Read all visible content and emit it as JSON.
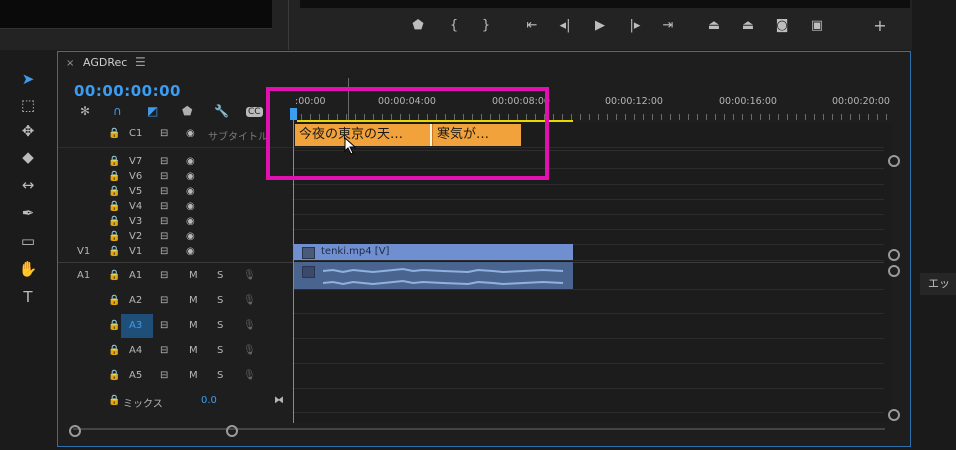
{
  "sequence": {
    "name": "AGDRec",
    "timecode": "00:00:00:00"
  },
  "ruler": {
    "ticks": [
      ":00:00",
      "00:00:04:00",
      "00:00:08:00",
      "00:00:12:00",
      "00:00:16:00",
      "00:00:20:00"
    ]
  },
  "caption_track": {
    "label": "C1",
    "placeholder": "サブタイトル"
  },
  "video_tracks": [
    "V7",
    "V6",
    "V5",
    "V4",
    "V3",
    "V2",
    "V1"
  ],
  "audio_tracks": [
    "A1",
    "A2",
    "A3",
    "A4",
    "A5"
  ],
  "source_patch": {
    "video": "V1",
    "audio": "A1"
  },
  "mix": {
    "label": "ミックス",
    "value": "0.0"
  },
  "captions": [
    {
      "text": "今夜の東京の天…"
    },
    {
      "text": "寒気が…"
    }
  ],
  "video_clip": {
    "label": "tenki.mp4 [V]"
  },
  "right_panel": {
    "tab": "エッセ"
  },
  "track_buttons": {
    "mute": "M",
    "solo": "S"
  },
  "colors": {
    "accent": "#3c9cf0",
    "highlight": "#e011b0",
    "caption": "#f2a23a",
    "video_clip": "#6f8fd0",
    "audio_clip": "#4a6490"
  }
}
